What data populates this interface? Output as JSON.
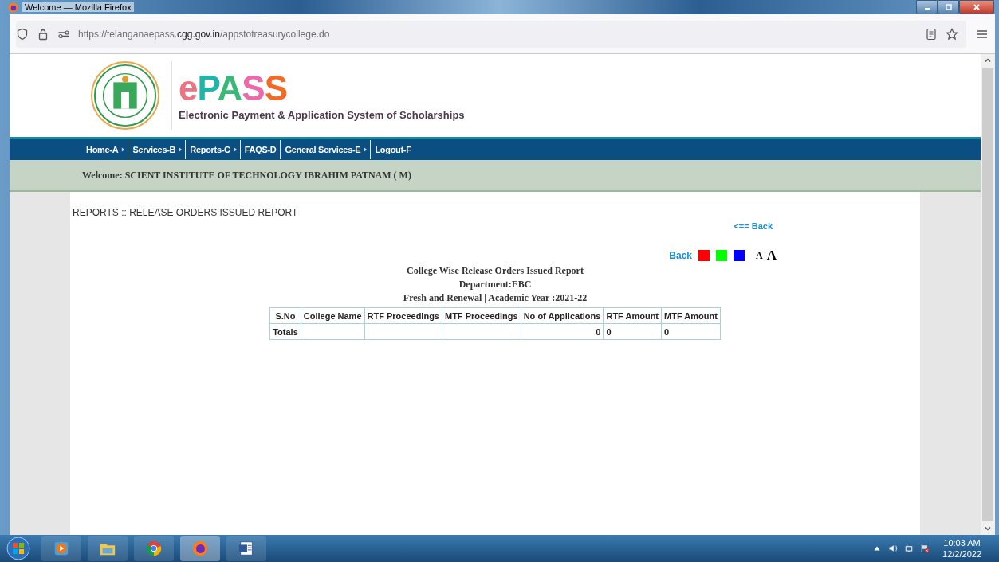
{
  "window": {
    "title": "Welcome — Mozilla Firefox"
  },
  "address_bar": {
    "prefix": "https://telanganaepass.",
    "domain": "cgg.gov.in",
    "path": "/appstotreasurycollege.do"
  },
  "header": {
    "wordmark": "ePASS",
    "tagline": "Electronic Payment & Application System of Scholarships"
  },
  "nav": [
    {
      "label": "Home-A",
      "has_submenu": true
    },
    {
      "label": "Services-B",
      "has_submenu": true
    },
    {
      "label": "Reports-C",
      "has_submenu": true
    },
    {
      "label": "FAQS-D",
      "has_submenu": false
    },
    {
      "label": "General Services-E",
      "has_submenu": true
    },
    {
      "label": "Logout-F",
      "has_submenu": false
    }
  ],
  "welcome": "Welcome: SCIENT INSTITUTE OF TECHNOLOGY IBRAHIM PATNAM ( M)",
  "breadcrumb": "REPORTS :: RELEASE ORDERS ISSUED REPORT",
  "back_link": "<== Back",
  "tools": {
    "back": "Back",
    "swatches": [
      {
        "color": "#ff0000"
      },
      {
        "color": "#00ff00"
      },
      {
        "color": "#0000ff"
      }
    ],
    "font_sizes": [
      {
        "label": "A",
        "kind": "small"
      },
      {
        "label": "A",
        "kind": "large"
      }
    ]
  },
  "report": {
    "titles": [
      "College Wise Release Orders Issued Report",
      "Department:EBC",
      "Fresh and Renewal | Academic Year :2021-22"
    ],
    "columns": [
      {
        "label": "S.No",
        "kind": "text",
        "total": "Totals"
      },
      {
        "label": "College Name",
        "kind": "text"
      },
      {
        "label": "RTF Proceedings",
        "kind": "text"
      },
      {
        "label": "MTF Proceedings",
        "kind": "text"
      },
      {
        "label": "No of Applications",
        "kind": "count",
        "total": "0"
      },
      {
        "label": "RTF Amount",
        "kind": "text",
        "total": "0"
      },
      {
        "label": "MTF Amount",
        "kind": "text",
        "total": "0"
      }
    ]
  },
  "taskbar": {
    "time": "10:03 AM",
    "date": "12/2/2022"
  }
}
